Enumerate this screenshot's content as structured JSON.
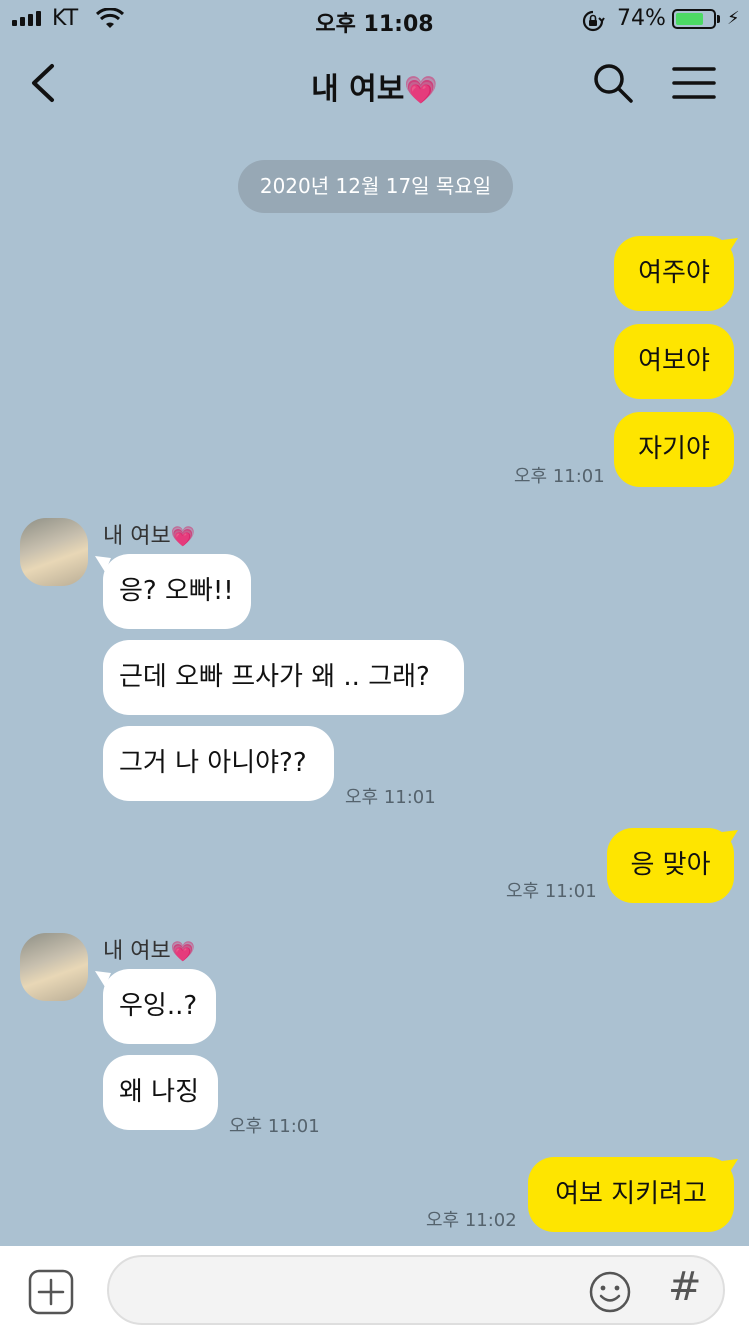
{
  "status_bar": {
    "carrier": "KT",
    "time": "오후 11:08",
    "battery_percent_text": "74%",
    "battery_level": 0.74
  },
  "header": {
    "title": "내 여보",
    "title_emoji": "💗"
  },
  "date_divider": "2020년 12월 17일 목요일",
  "messages": [
    {
      "from": "me",
      "text": "여주야"
    },
    {
      "from": "me",
      "text": "여보야"
    },
    {
      "from": "me",
      "text": "자기야",
      "time": "오후 11:01"
    },
    {
      "from": "them",
      "sender": "내 여보",
      "sender_emoji": "💗",
      "text": "응? 오빠!!"
    },
    {
      "from": "them",
      "text": "근데 오빠 프사가 왜 .. 그래?"
    },
    {
      "from": "them",
      "text": "그거 나 아니야??",
      "time": "오후 11:01"
    },
    {
      "from": "me",
      "text": "응 맞아",
      "time": "오후 11:01"
    },
    {
      "from": "them",
      "sender": "내 여보",
      "sender_emoji": "💗",
      "text": "우잉..?"
    },
    {
      "from": "them",
      "text": "왜 나징",
      "time": "오후 11:01"
    },
    {
      "from": "me",
      "text": "여보 지키려고",
      "time": "오후 11:02"
    }
  ],
  "input": {
    "value": "",
    "placeholder": ""
  },
  "colors": {
    "background": "#abc1d1",
    "my_bubble": "#fee500",
    "their_bubble": "#ffffff",
    "battery": "#4cd964"
  },
  "icons": [
    "back-icon",
    "search-icon",
    "menu-icon",
    "plus-icon",
    "emoji-icon",
    "hashtag-icon"
  ]
}
